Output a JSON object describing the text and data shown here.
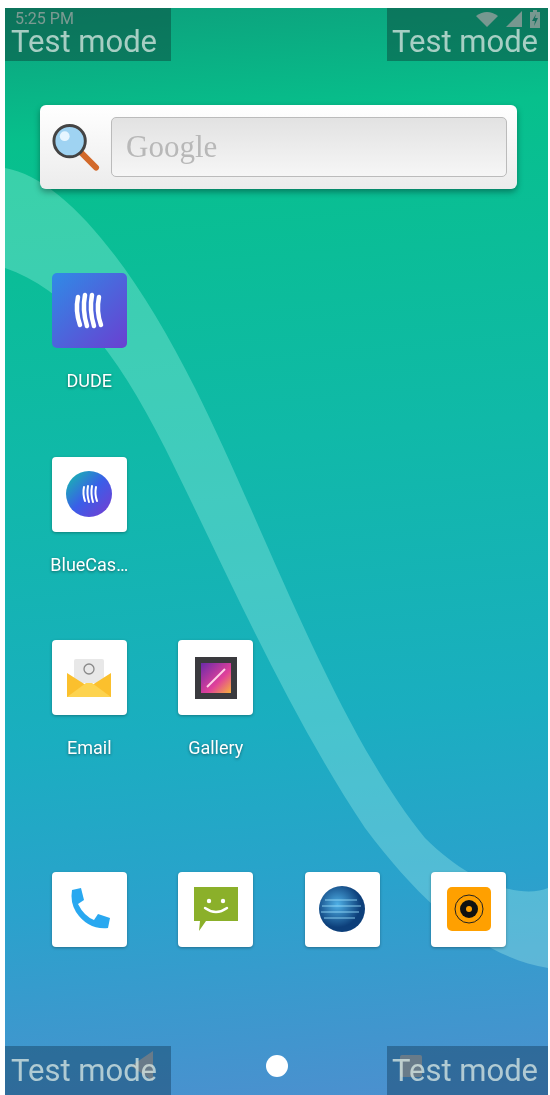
{
  "status_bar": {
    "time": "5:25 PM"
  },
  "search_widget": {
    "placeholder": "Google"
  },
  "home_rows": [
    {
      "apps": [
        {
          "label": "DUDE",
          "kind": "dude"
        }
      ]
    },
    {
      "apps": [
        {
          "label": "BlueCas…",
          "kind": "bluecast"
        }
      ]
    },
    {
      "apps": [
        {
          "label": "Email",
          "kind": "email"
        },
        {
          "label": "Gallery",
          "kind": "gallery"
        }
      ]
    }
  ],
  "dock": [
    {
      "kind": "phone"
    },
    {
      "kind": "messaging"
    },
    {
      "kind": "browser"
    },
    {
      "kind": "camera"
    }
  ],
  "test_mode_overlays": [
    {
      "label": "Test mode"
    },
    {
      "label": "Test mode"
    },
    {
      "label": "Test mode"
    },
    {
      "label": "Test mode"
    }
  ]
}
